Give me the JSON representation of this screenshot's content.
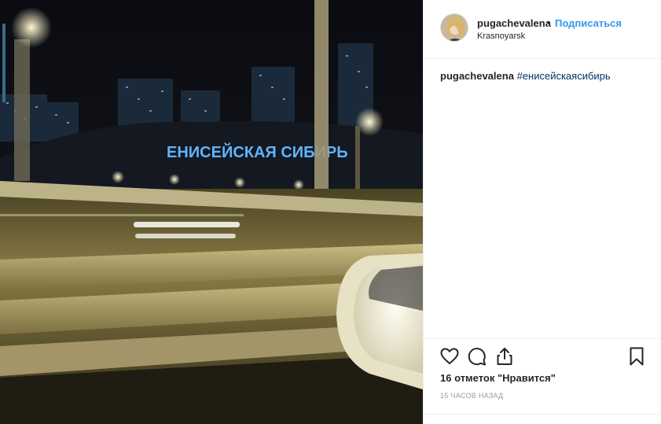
{
  "header": {
    "username": "pugachevalena",
    "separator": "•",
    "follow_label": "Подписаться",
    "location": "Krasnoyarsk"
  },
  "photo": {
    "sign_text": "ЕНИСЕЙСКАЯ СИБИРЬ"
  },
  "caption": {
    "username": "pugachevalena",
    "hashtag": "#енисейскаясибирь"
  },
  "actions": {
    "icons": [
      "heart-icon",
      "comment-icon",
      "share-icon",
      "bookmark-icon"
    ],
    "likes_text": "16 отметок \"Нравится\"",
    "time_text": "15 часов назад"
  },
  "colors": {
    "accent": "#3897f0",
    "hashtag": "#003569",
    "text": "#262626",
    "muted": "#999999",
    "border": "#efefef"
  }
}
